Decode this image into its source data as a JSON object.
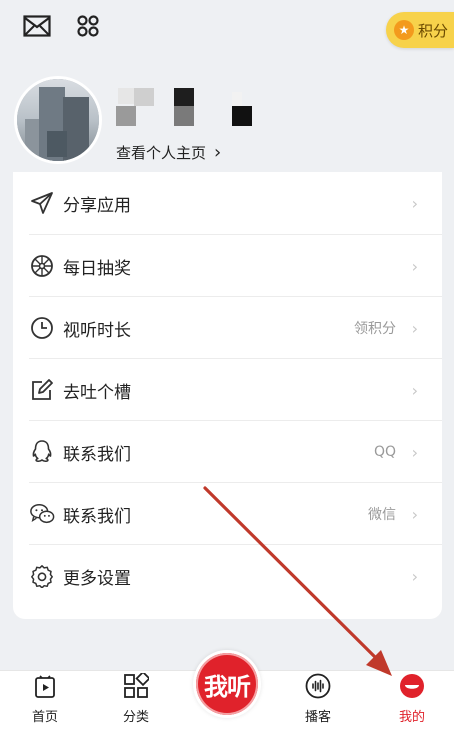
{
  "topbar": {
    "mail_icon": "mail-icon",
    "apps_icon": "apps-icon",
    "points_label": "积分"
  },
  "profile": {
    "view_home_label": "查看个人主页",
    "chevron": "›"
  },
  "menu": {
    "items": [
      {
        "label": "分享应用",
        "value": "",
        "icon": "paper-plane-icon"
      },
      {
        "label": "每日抽奖",
        "value": "",
        "icon": "lottery-wheel-icon"
      },
      {
        "label": "视听时长",
        "value": "领积分",
        "icon": "clock-icon"
      },
      {
        "label": "去吐个槽",
        "value": "",
        "icon": "edit-icon"
      },
      {
        "label": "联系我们",
        "value": "QQ",
        "icon": "qq-icon"
      },
      {
        "label": "联系我们",
        "value": "微信",
        "icon": "wechat-icon"
      },
      {
        "label": "更多设置",
        "value": "",
        "icon": "gear-icon"
      }
    ],
    "chevron": "›"
  },
  "tabbar": {
    "home_label": "首页",
    "category_label": "分类",
    "center_label": "我听",
    "podcast_label": "播客",
    "mine_label": "我的"
  },
  "colors": {
    "accent": "#e0222b",
    "points_bg": "#f7d24b",
    "page_bg": "#eef0f3",
    "annotation_arrow": "#c0392b"
  }
}
